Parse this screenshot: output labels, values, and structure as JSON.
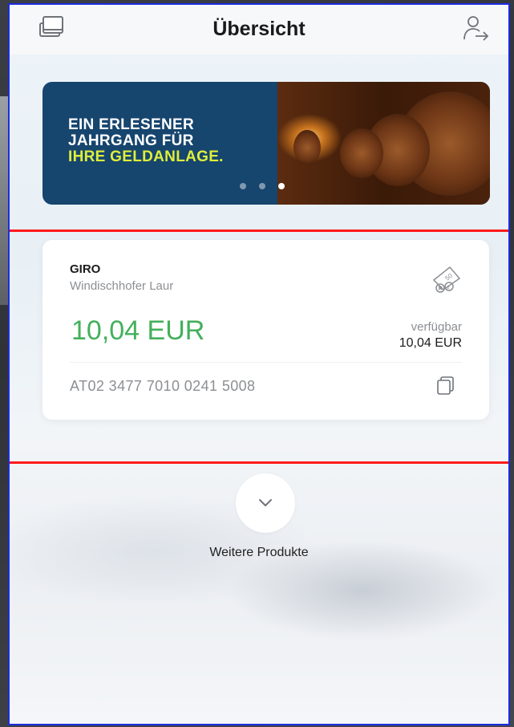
{
  "header": {
    "title": "Übersicht",
    "left_icon": "cards-stack-icon",
    "right_icon": "user-logout-icon"
  },
  "banner": {
    "line1": "EIN ERLESENER",
    "line2": "JAHRGANG FÜR",
    "line3": "IHRE GELDANLAGE.",
    "slide_count": 3,
    "active_slide": 3,
    "highlight_color": "#dfef3a"
  },
  "account": {
    "type": "GIRO",
    "owner": "Windischhofer Laur",
    "balance": "10,04 EUR",
    "available_label": "verfügbar",
    "available_value": "10,04 EUR",
    "iban": "AT02 3477 7010 0241 5008",
    "balance_color": "#43b05c",
    "card_icon": "card-limit-icon",
    "copy_icon": "copy-icon"
  },
  "more": {
    "label": "Weitere Produkte",
    "icon": "chevron-down-icon"
  }
}
